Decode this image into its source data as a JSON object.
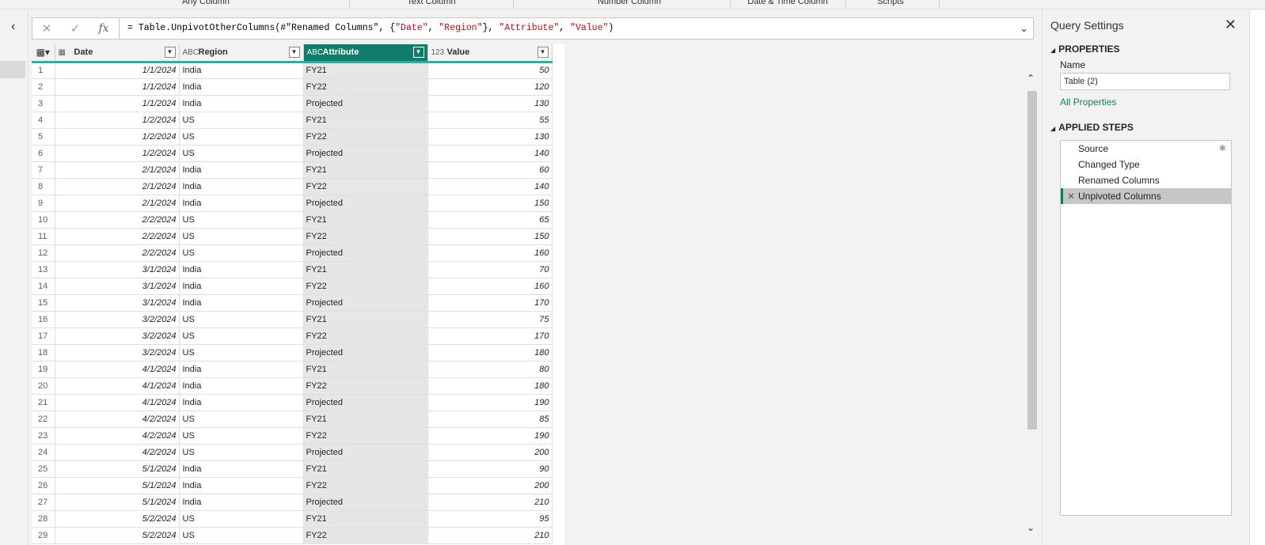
{
  "ribbon": {
    "groups": [
      "Any Column",
      "Text Column",
      "Number Column",
      "Date & Time Column",
      "Scripts"
    ]
  },
  "formula_bar": {
    "cancel_icon": "close-icon",
    "commit_icon": "check-icon",
    "fx_label": "fx",
    "formula_prefix": "= Table.UnpivotOtherColumns(#\"Renamed Columns\", {",
    "str1": "\"Date\"",
    "sep1": ", ",
    "str2": "\"Region\"",
    "mid": "}, ",
    "str3": "\"Attribute\"",
    "sep2": ", ",
    "str4": "\"Value\"",
    "suffix": ")"
  },
  "grid": {
    "columns": [
      {
        "name": "Date",
        "type_icon": "calendar-table-icon"
      },
      {
        "name": "Region",
        "type_icon": "ABC"
      },
      {
        "name": "Attribute",
        "type_icon": "ABC"
      },
      {
        "name": "Value",
        "type_icon": "123"
      }
    ],
    "rows": [
      [
        "1",
        "1/1/2024",
        "India",
        "FY21",
        "50"
      ],
      [
        "2",
        "1/1/2024",
        "India",
        "FY22",
        "120"
      ],
      [
        "3",
        "1/1/2024",
        "India",
        "Projected",
        "130"
      ],
      [
        "4",
        "1/2/2024",
        "US",
        "FY21",
        "55"
      ],
      [
        "5",
        "1/2/2024",
        "US",
        "FY22",
        "130"
      ],
      [
        "6",
        "1/2/2024",
        "US",
        "Projected",
        "140"
      ],
      [
        "7",
        "2/1/2024",
        "India",
        "FY21",
        "60"
      ],
      [
        "8",
        "2/1/2024",
        "India",
        "FY22",
        "140"
      ],
      [
        "9",
        "2/1/2024",
        "India",
        "Projected",
        "150"
      ],
      [
        "10",
        "2/2/2024",
        "US",
        "FY21",
        "65"
      ],
      [
        "11",
        "2/2/2024",
        "US",
        "FY22",
        "150"
      ],
      [
        "12",
        "2/2/2024",
        "US",
        "Projected",
        "160"
      ],
      [
        "13",
        "3/1/2024",
        "India",
        "FY21",
        "70"
      ],
      [
        "14",
        "3/1/2024",
        "India",
        "FY22",
        "160"
      ],
      [
        "15",
        "3/1/2024",
        "India",
        "Projected",
        "170"
      ],
      [
        "16",
        "3/2/2024",
        "US",
        "FY21",
        "75"
      ],
      [
        "17",
        "3/2/2024",
        "US",
        "FY22",
        "170"
      ],
      [
        "18",
        "3/2/2024",
        "US",
        "Projected",
        "180"
      ],
      [
        "19",
        "4/1/2024",
        "India",
        "FY21",
        "80"
      ],
      [
        "20",
        "4/1/2024",
        "India",
        "FY22",
        "180"
      ],
      [
        "21",
        "4/1/2024",
        "India",
        "Projected",
        "190"
      ],
      [
        "22",
        "4/2/2024",
        "US",
        "FY21",
        "85"
      ],
      [
        "23",
        "4/2/2024",
        "US",
        "FY22",
        "190"
      ],
      [
        "24",
        "4/2/2024",
        "US",
        "Projected",
        "200"
      ],
      [
        "25",
        "5/1/2024",
        "India",
        "FY21",
        "90"
      ],
      [
        "26",
        "5/1/2024",
        "India",
        "FY22",
        "200"
      ],
      [
        "27",
        "5/1/2024",
        "India",
        "Projected",
        "210"
      ],
      [
        "28",
        "5/2/2024",
        "US",
        "FY21",
        "95"
      ],
      [
        "29",
        "5/2/2024",
        "US",
        "FY22",
        "210"
      ]
    ],
    "selected_column": "Attribute"
  },
  "query_settings": {
    "title": "Query Settings",
    "properties_header": "PROPERTIES",
    "name_label": "Name",
    "name_value": "Table (2)",
    "all_properties": "All Properties",
    "applied_steps_header": "APPLIED STEPS",
    "steps": [
      {
        "label": "Source",
        "has_gear": true
      },
      {
        "label": "Changed Type",
        "has_gear": false
      },
      {
        "label": "Renamed Columns",
        "has_gear": false
      },
      {
        "label": "Unpivoted Columns",
        "has_gear": false,
        "active": true
      }
    ]
  },
  "colors": {
    "accent_teal": "#107c6a",
    "header_underline": "#21b4a3",
    "string_literal": "#a31515"
  }
}
